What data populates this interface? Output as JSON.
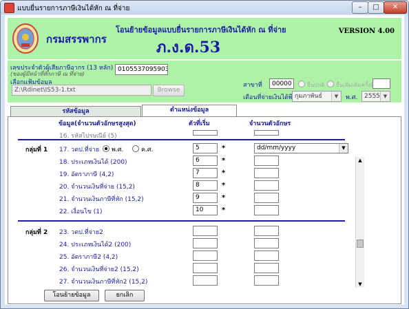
{
  "window": {
    "title": "แบบยื่นรายการภาษีเงินได้หัก ณ ที่จ่าย",
    "minimize_glyph": "–",
    "maximize_glyph": "□",
    "close_glyph": "✕"
  },
  "header": {
    "department": "กรมสรรพากร",
    "title": "โอนย้ายข้อมูลแบบยื่นรายการภาษีเงินได้หัก ณ ที่จ่าย",
    "form_code": "ภ.ง.ด.53",
    "version": "VERSION 4.00"
  },
  "info": {
    "taxid_label": "เลขประจำตัวผู้เสียภาษีอากร (13 หลัก)",
    "taxid_note": "(ของผู้มีหน้าที่หักภาษี ณ ที่จ่าย)",
    "taxid_value": "0105537095903",
    "file_label": "เลือกแฟ้มข้อมูล",
    "file_path": "Z:\\Rdinet\\IS53-1.txt",
    "browse_label": "Browse",
    "branch_label": "สาขาที่",
    "branch_value": "00000",
    "normal_label": "ยื่นปกติ",
    "extra_label": "ยื่นเพิ่มเติมครั้งที่",
    "period_label": "เดือนที่จ่ายเงินได้พึงประเมิน",
    "month_value": "กุมภาพันธ์",
    "year_label": "พ.ศ.",
    "year_value": "2555"
  },
  "tabs": [
    {
      "label": "รหัสข้อมูล",
      "active": false
    },
    {
      "label": "ตำแหน่งข้อมูล",
      "active": true
    }
  ],
  "columns": {
    "field": "ข้อมูล(จำนวนตัวอักษรสูงสุด)",
    "start": "ตัวที่เริ่ม",
    "length": "จำนวนตัวอักษร"
  },
  "rows": [
    {
      "label": "16. รหัสไปรษณีย์ (5)",
      "pos": "",
      "star": ""
    },
    {
      "label": "17. วดป.ที่จ่าย",
      "pos": "5",
      "star": "*"
    },
    {
      "label": "18. ประเภทเงินได้ (200)",
      "pos": "6",
      "star": "*"
    },
    {
      "label": "19. อัตราภาษี (4,2)",
      "pos": "7",
      "star": "*"
    },
    {
      "label": "20. จำนวนเงินที่จ่าย (15,2)",
      "pos": "8",
      "star": "*"
    },
    {
      "label": "21. จำนวนเงินภาษีที่หัก (15,2)",
      "pos": "9",
      "star": "*"
    },
    {
      "label": "22. เงื่อนไข (1)",
      "pos": "10",
      "star": "*"
    },
    {
      "label": "23. วดป.ที่จ่าย2",
      "pos": "",
      "star": ""
    },
    {
      "label": "24. ประเภทเงินได้2 (200)",
      "pos": "",
      "star": ""
    },
    {
      "label": "25. อัตราภาษี2 (4,2)",
      "pos": "",
      "star": ""
    },
    {
      "label": "26. จำนวนเงินที่จ่าย2 (15,2)",
      "pos": "",
      "star": ""
    },
    {
      "label": "27. จำนวนเงินภาษีที่หัก2 (15,2)",
      "pos": "",
      "star": ""
    }
  ],
  "groups": {
    "group1": "กลุ่มที่ 1",
    "group2": "กลุ่มที่ 2"
  },
  "date_options": {
    "be": "พ.ศ.",
    "ce": "ค.ศ.",
    "format": "dd/mm/yyyy"
  },
  "footer": {
    "transfer_label": "โอนย้ายข้อมูล",
    "cancel_label": "ยกเลิก"
  }
}
